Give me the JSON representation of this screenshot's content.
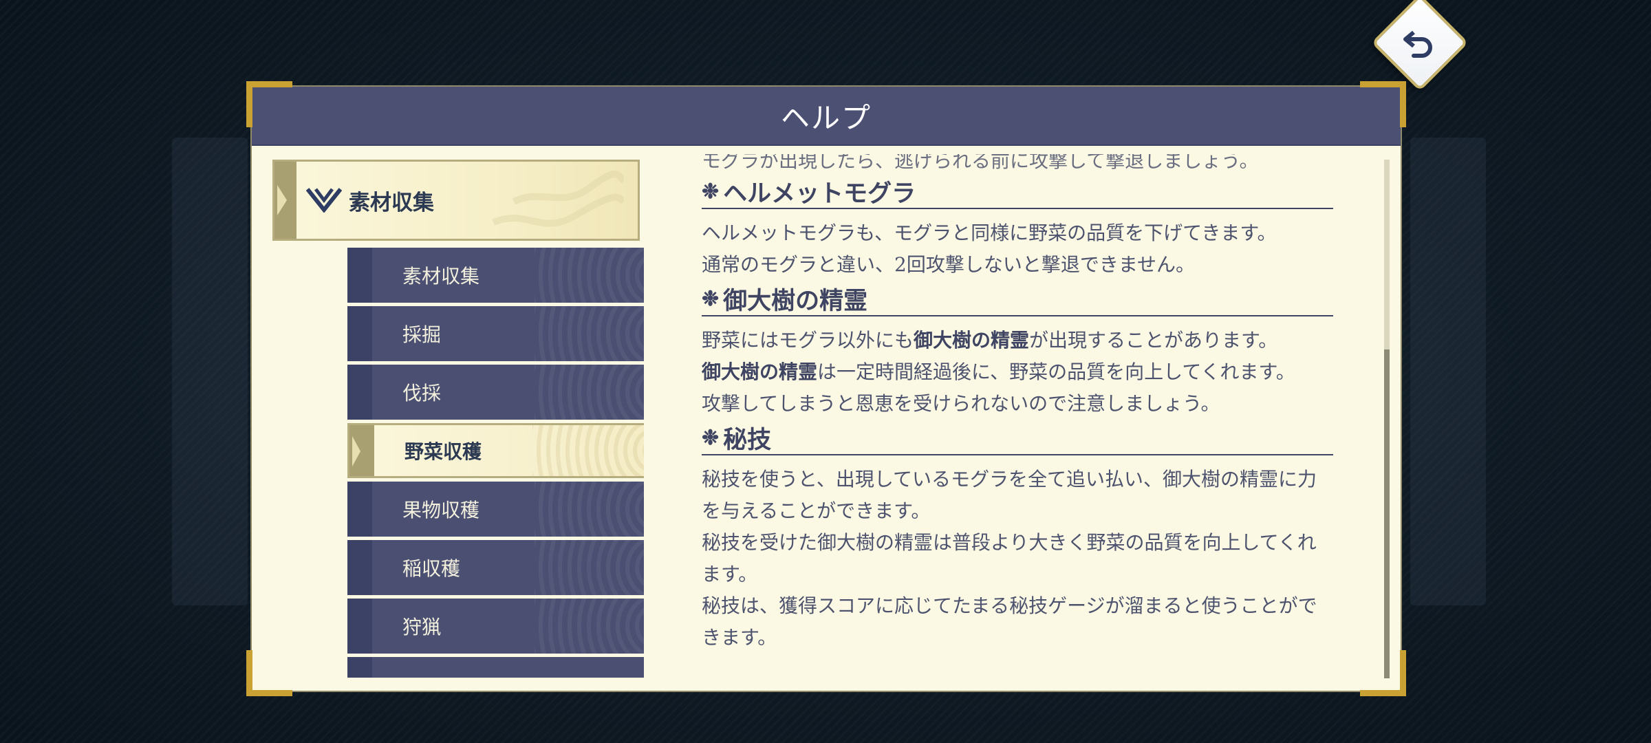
{
  "dialog": {
    "title": "ヘルプ"
  },
  "nav": {
    "category": "素材収集",
    "items": [
      {
        "label": "素材収集",
        "active": false
      },
      {
        "label": "採掘",
        "active": false
      },
      {
        "label": "伐採",
        "active": false
      },
      {
        "label": "野菜収穫",
        "active": true
      },
      {
        "label": "果物収穫",
        "active": false
      },
      {
        "label": "稲収穫",
        "active": false
      },
      {
        "label": "狩猟",
        "active": false
      }
    ]
  },
  "content": {
    "cut_line": "モグラが出現したら、逃げられる前に攻撃して撃退しましょう。",
    "sections": [
      {
        "title": "ヘルメットモグラ",
        "lines": [
          "ヘルメットモグラも、モグラと同様に野菜の品質を下げてきます。",
          "通常のモグラと違い、2回攻撃しないと撃退できません。"
        ]
      },
      {
        "title": "御大樹の精霊",
        "line1_bold": "御大樹の精霊",
        "line1_pre": "野菜にはモグラ以外にも",
        "line1_post": "が出現することがあります。",
        "line2_bold": "御大樹の精霊",
        "line2_post": "は一定時間経過後に、野菜の品質を向上してくれます。",
        "line3": "攻撃してしまうと恩恵を受けられないので注意しましょう。"
      },
      {
        "title": "秘技",
        "paragraphs": [
          "秘技を使うと、出現しているモグラを全て追い払い、御大樹の精霊に力を与えることができます。",
          "秘技を受けた御大樹の精霊は普段より大きく野菜の品質を向上してくれます。",
          "秘技は、獲得スコアに応じてたまる秘技ゲージが溜まると使うことができます。"
        ]
      }
    ]
  },
  "colors": {
    "header": "#4c5173",
    "panel": "#fbf9e3",
    "nav_item": "#4b5073",
    "gold": "#c9a233"
  },
  "icons": {
    "back": "back-arrow-icon",
    "section": "flower-icon",
    "category": "chevron-down-icon"
  }
}
